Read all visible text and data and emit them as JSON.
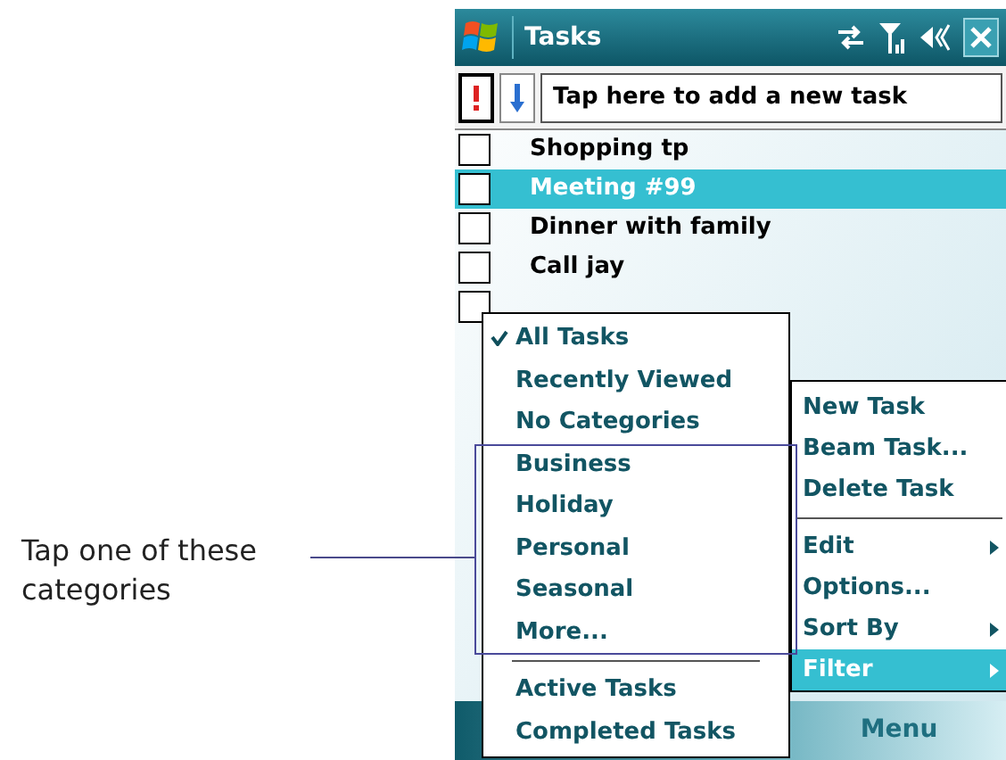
{
  "title_bar": {
    "title": "Tasks"
  },
  "toolbar": {
    "placeholder": "Tap here to add a new task"
  },
  "tasks": [
    {
      "name": "Shopping tp",
      "checked": false,
      "selected": false
    },
    {
      "name": "Meeting #99",
      "checked": false,
      "selected": true
    },
    {
      "name": "Dinner with family",
      "checked": false,
      "selected": false
    },
    {
      "name": "Call jay",
      "checked": false,
      "selected": false
    },
    {
      "checked": false,
      "selected": false
    }
  ],
  "filter_menu": {
    "items": [
      {
        "kind": "item",
        "label": "All Tasks",
        "checked": true
      },
      {
        "kind": "item",
        "label": "Recently Viewed",
        "checked": false
      },
      {
        "kind": "item",
        "label": "No Categories",
        "checked": false
      },
      {
        "kind": "item",
        "label": "Business",
        "checked": false
      },
      {
        "kind": "item",
        "label": "Holiday",
        "checked": false
      },
      {
        "kind": "item",
        "label": "Personal",
        "checked": false
      },
      {
        "kind": "item",
        "label": "Seasonal",
        "checked": false
      },
      {
        "kind": "item",
        "label": "More...",
        "checked": false
      },
      {
        "kind": "separator"
      },
      {
        "kind": "item",
        "label": "Active Tasks",
        "checked": false
      },
      {
        "kind": "item",
        "label": "Completed Tasks",
        "checked": false
      }
    ]
  },
  "main_menu": {
    "items": [
      {
        "kind": "item",
        "label": "New Task",
        "submenu": false,
        "selected": false
      },
      {
        "kind": "item",
        "label": "Beam Task...",
        "submenu": false,
        "selected": false
      },
      {
        "kind": "item",
        "label": "Delete Task",
        "submenu": false,
        "selected": false
      },
      {
        "kind": "separator"
      },
      {
        "kind": "item",
        "label": "Edit",
        "submenu": true,
        "selected": false
      },
      {
        "kind": "item",
        "label": "Options...",
        "submenu": false,
        "selected": false
      },
      {
        "kind": "item",
        "label": "Sort By",
        "submenu": true,
        "selected": false
      },
      {
        "kind": "item",
        "label": "Filter",
        "submenu": true,
        "selected": true
      }
    ]
  },
  "softkeys": {
    "right": "Menu"
  },
  "annotation": {
    "text": "Tap one of these categories"
  }
}
